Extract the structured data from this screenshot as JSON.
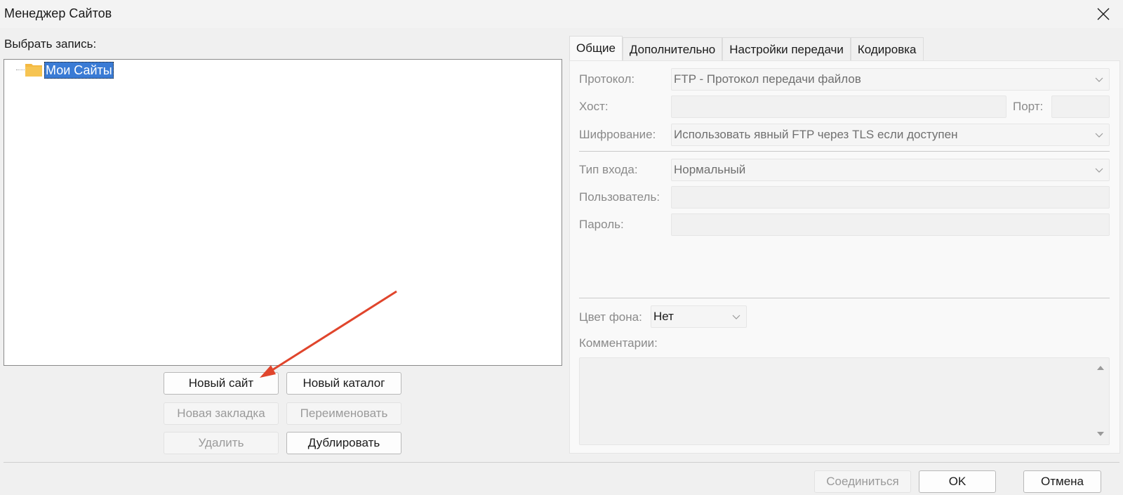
{
  "window": {
    "title": "Менеджер Сайтов"
  },
  "left": {
    "select_label": "Выбрать запись:",
    "tree": {
      "root_label": "Мои Сайты"
    },
    "buttons": {
      "new_site": "Новый сайт",
      "new_folder": "Новый каталог",
      "new_bookmark": "Новая закладка",
      "rename": "Переименовать",
      "delete": "Удалить",
      "duplicate": "Дублировать"
    }
  },
  "tabs": [
    "Общие",
    "Дополнительно",
    "Настройки передачи",
    "Кодировка"
  ],
  "general": {
    "protocol_label": "Протокол:",
    "protocol_value": "FTP - Протокол передачи файлов",
    "host_label": "Хост:",
    "host_value": "",
    "port_label": "Порт:",
    "port_value": "",
    "encryption_label": "Шифрование:",
    "encryption_value": "Использовать явный FTP через TLS если доступен",
    "logon_type_label": "Тип входа:",
    "logon_type_value": "Нормальный",
    "user_label": "Пользователь:",
    "user_value": "",
    "password_label": "Пароль:",
    "password_value": "",
    "bg_color_label": "Цвет фона:",
    "bg_color_value": "Нет",
    "comments_label": "Комментарии:",
    "comments_value": ""
  },
  "footer": {
    "connect": "Соединиться",
    "ok": "OK",
    "cancel": "Отмена"
  },
  "colors": {
    "selection": "#3a7bd5",
    "folder": "#f4b942",
    "annotation_arrow": "#e0452c"
  }
}
